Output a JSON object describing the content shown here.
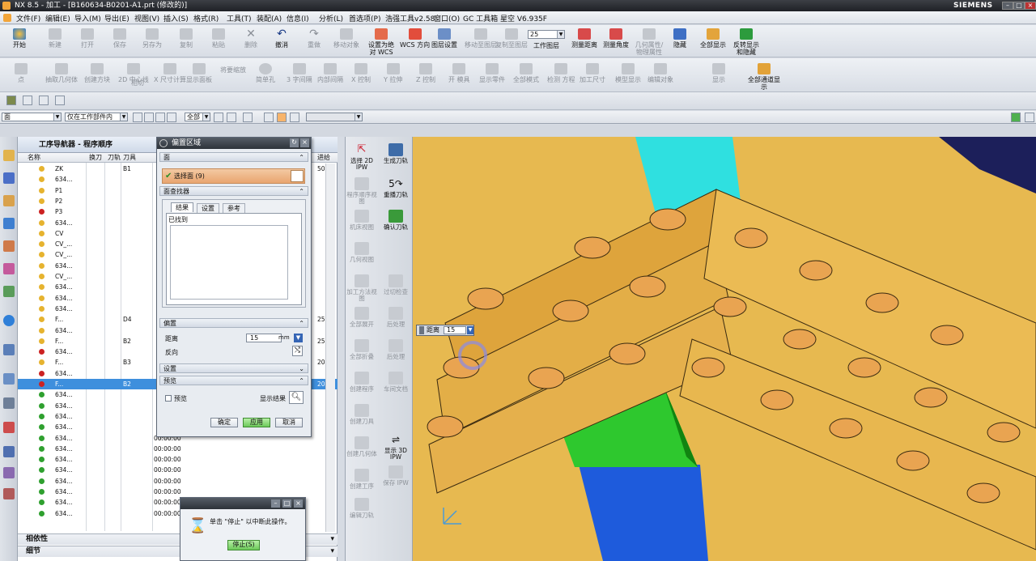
{
  "titlebar": {
    "title": "NX 8.5 - 加工 - [B160634-B0201-A1.prt (修改的)]",
    "brand": "SIEMENS"
  },
  "menubar": {
    "items": [
      "文件(F)",
      "编辑(E)",
      "导入(M)",
      "导出(E)",
      "视图(V)",
      "插入(S)",
      "格式(R)",
      "工具(T)",
      "装配(A)",
      "信息(I)",
      "分析(L)",
      "首选项(P)",
      "浩强工具v2.58",
      "窗口(O)",
      "GC 工具箱",
      "星空 V6.935F"
    ]
  },
  "toolbar1": {
    "items": [
      "开始",
      "新建",
      "打开",
      "保存",
      "另存为",
      "复制",
      "粘贴",
      "删除",
      "撤消",
      "重做",
      "移动对象",
      "设置为绝对 WCS",
      "WCS 方向",
      "图层设置",
      "移动至图层",
      "复制至图层",
      "工作图层",
      "测量距离",
      "测量角度",
      "几何属性/物理属性",
      "隐藏",
      "全部显示",
      "反转显示和隐藏"
    ],
    "layer_value": "25"
  },
  "toolbar2": {
    "items": [
      "点",
      "抽取几何体",
      "创建方块",
      "2D 中心线",
      "相切",
      "X 尺寸计算",
      "显示面板",
      "将要缩放",
      "简单孔",
      "3 字间隔",
      "内部间隔",
      "X 控制",
      "Y 拉伸",
      "Z 控制",
      "开 模具",
      "显示零件",
      "全部模式",
      "检测 方程",
      "加工尺寸",
      "模型显示",
      "编辑对象",
      "显示",
      "全部通道显示"
    ]
  },
  "filterbar": {
    "type_filter": "面",
    "scope_filter": "仅在工作部件内",
    "snap_filter": "全部"
  },
  "navigator": {
    "title": "工序导航器 - 程序顺序",
    "columns": [
      "名称",
      "换刀",
      "刀轨",
      "刀具",
      "进给"
    ],
    "rows": [
      {
        "name": "ZK",
        "tool": "B1",
        "time": "",
        "feed": "50"
      },
      {
        "name": "634...",
        "tool": "",
        "time": "",
        "feed": ""
      },
      {
        "name": "P1",
        "tool": "",
        "time": "",
        "feed": ""
      },
      {
        "name": "P2",
        "tool": "",
        "time": "",
        "feed": ""
      },
      {
        "name": "P3",
        "tool": "",
        "time": "",
        "feed": ""
      },
      {
        "name": "634...",
        "tool": "",
        "time": "",
        "feed": ""
      },
      {
        "name": "CV",
        "tool": "",
        "time": "",
        "feed": ""
      },
      {
        "name": "CV_...",
        "tool": "",
        "time": "",
        "feed": ""
      },
      {
        "name": "CV_...",
        "tool": "",
        "time": "",
        "feed": ""
      },
      {
        "name": "634...",
        "tool": "",
        "time": "",
        "feed": ""
      },
      {
        "name": "CV_...",
        "tool": "",
        "time": "",
        "feed": ""
      },
      {
        "name": "634...",
        "tool": "",
        "time": "",
        "feed": ""
      },
      {
        "name": "634...",
        "tool": "",
        "time": "",
        "feed": ""
      },
      {
        "name": "634...",
        "tool": "",
        "time": "",
        "feed": ""
      },
      {
        "name": "F...",
        "tool": "D4",
        "time": "",
        "feed": "250"
      },
      {
        "name": "634...",
        "tool": "",
        "time": "",
        "feed": ""
      },
      {
        "name": "F...",
        "tool": "B2",
        "time": "",
        "feed": "250"
      },
      {
        "name": "634...",
        "tool": "",
        "time": "",
        "feed": ""
      },
      {
        "name": "F...",
        "tool": "B3",
        "time": "",
        "feed": "200"
      },
      {
        "name": "634...",
        "tool": "",
        "time": "",
        "feed": ""
      },
      {
        "name": "F...",
        "tool": "B2",
        "time": "",
        "feed": "200"
      },
      {
        "name": "634...",
        "tool": "",
        "time": "",
        "feed": ""
      },
      {
        "name": "634...",
        "tool": "",
        "time": "",
        "feed": ""
      },
      {
        "name": "634...",
        "tool": "",
        "time": "",
        "feed": ""
      },
      {
        "name": "634...",
        "tool": "",
        "time": "",
        "feed": ""
      },
      {
        "name": "634...",
        "tool": "",
        "time": "00:00:00",
        "feed": ""
      },
      {
        "name": "634...",
        "tool": "",
        "time": "00:00:00",
        "feed": ""
      },
      {
        "name": "634...",
        "tool": "",
        "time": "00:00:00",
        "feed": ""
      },
      {
        "name": "634...",
        "tool": "",
        "time": "00:00:00",
        "feed": ""
      },
      {
        "name": "634...",
        "tool": "",
        "time": "00:00:00",
        "feed": ""
      },
      {
        "name": "634...",
        "tool": "",
        "time": "00:00:00",
        "feed": ""
      },
      {
        "name": "634...",
        "tool": "",
        "time": "00:00:00",
        "feed": ""
      },
      {
        "name": "634...",
        "tool": "",
        "time": "00:00:00",
        "feed": ""
      }
    ],
    "selected_index": 20,
    "bottom_panels": [
      "相依性",
      "细节"
    ]
  },
  "dialog": {
    "title": "偏置区域",
    "face_section": "面",
    "select_face": "选择面 (9)",
    "finder_section": "面查找器",
    "tabs": [
      "结果",
      "设置",
      "参考"
    ],
    "found_label": "已找到",
    "offset_section": "偏置",
    "distance_label": "距离",
    "distance_value": "15",
    "distance_unit": "mm",
    "reverse_label": "反向",
    "settings_section": "设置",
    "preview_section": "预览",
    "preview_checkbox": "预览",
    "show_result": "显示结果",
    "ok": "确定",
    "apply": "应用",
    "cancel": "取消"
  },
  "rightbar": {
    "items": [
      "选择 2D IPW",
      "生成刀轨",
      "程序顺序视图",
      "重播刀轨",
      "机床视图",
      "确认刀轨",
      "几何视图",
      "加工方法视图",
      "过切检查",
      "全部展开",
      "后处理",
      "全部折叠",
      "后处理",
      "创建程序",
      "车间文档",
      "创建刀具",
      "创建几何体",
      "显示 3D IPW",
      "创建工序",
      "保存 IPW",
      "编辑刀轨"
    ]
  },
  "viewport": {
    "distance_label": "距离",
    "distance_value": "15",
    "colors": {
      "part": "#e7b950",
      "cyan": "#2fe0e0",
      "green": "#2ec82e",
      "blue": "#1e5bdc",
      "navy": "#1c1f5a"
    }
  },
  "stopdialog": {
    "message": "单击 \"停止\" 以中断此操作。",
    "button": "停止(S)"
  }
}
